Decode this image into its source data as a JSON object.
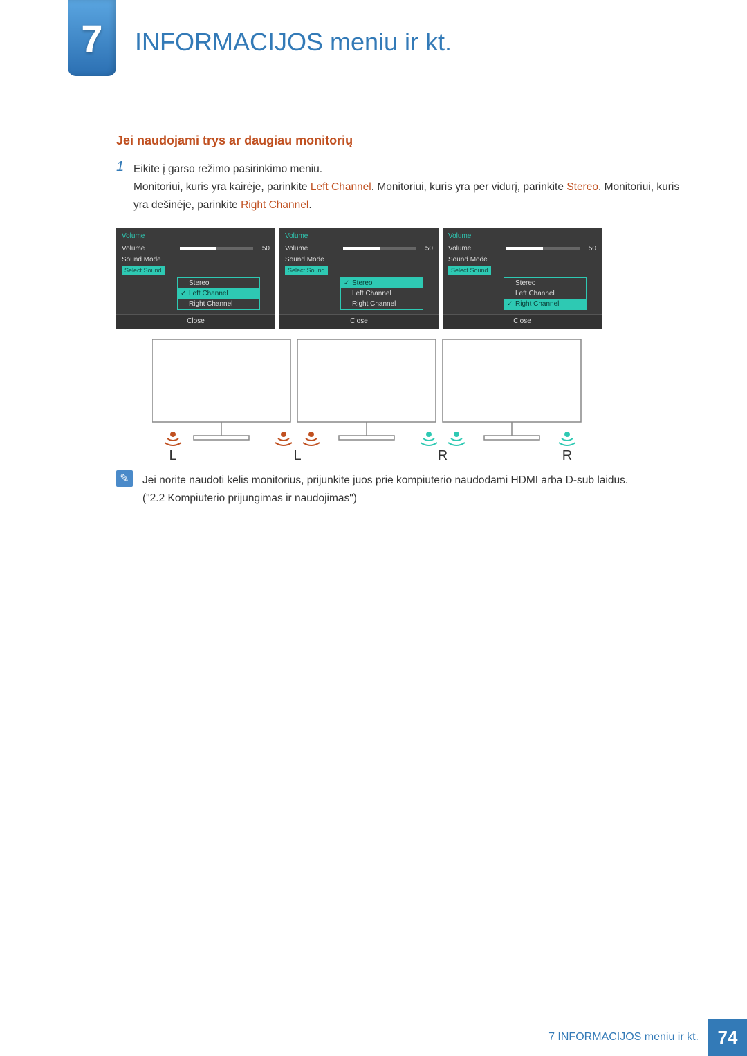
{
  "chapter": {
    "number": "7",
    "title": "INFORMACIJOS meniu ir kt."
  },
  "section": {
    "title": "Jei naudojami trys ar daugiau monitorių"
  },
  "step": {
    "num": "1",
    "line1": "Eikite į garso režimo pasirinkimo meniu.",
    "line2a": "Monitoriui, kuris yra kairėje, parinkite ",
    "hl1": "Left Channel",
    "line2b": ". Monitoriui, kuris yra per vidurį, parinkite ",
    "hl2": "Stereo",
    "line2c": ". Monitoriui, kuris yra dešinėje, parinkite ",
    "hl3": "Right Channel",
    "line2d": "."
  },
  "menu": {
    "title": "Volume",
    "volume_label": "Volume",
    "volume_value": "50",
    "sound_mode_label": "Sound Mode",
    "select_sound_label": "Select Sound",
    "opt_stereo": "Stereo",
    "opt_left": "Left Channel",
    "opt_right": "Right Channel",
    "close": "Close"
  },
  "fig_labels": {
    "L": "L",
    "R": "R"
  },
  "note": {
    "line1": "Jei norite naudoti kelis monitorius, prijunkite juos prie kompiuterio naudodami HDMI arba D-sub laidus.",
    "line2": "(\"2.2 Kompiuterio prijungimas ir naudojimas\")"
  },
  "footer": {
    "label": "7 INFORMACIJOS meniu ir kt.",
    "page": "74"
  }
}
